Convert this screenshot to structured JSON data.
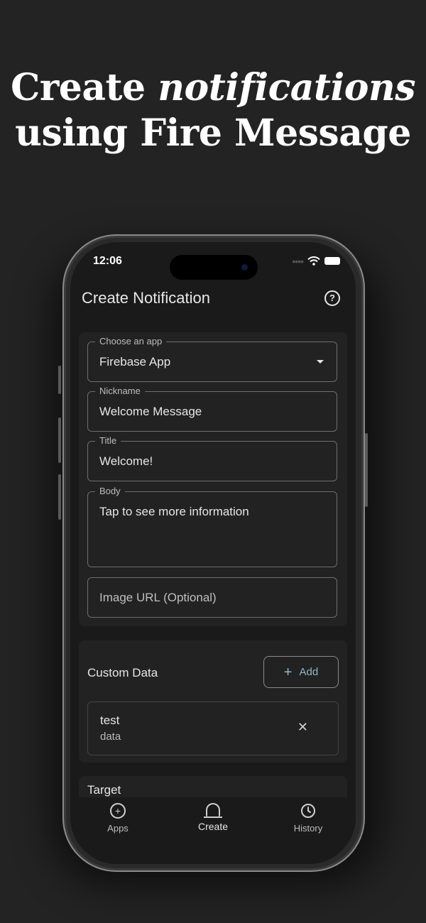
{
  "headline": {
    "line1_prefix": "Create ",
    "line1_emphasis": "notifications",
    "line2": "using Fire Message"
  },
  "status_bar": {
    "time": "12:06"
  },
  "header": {
    "title": "Create Notification",
    "help_icon": "help-circle-icon"
  },
  "form": {
    "app": {
      "label": "Choose an app",
      "value": "Firebase App"
    },
    "nickname": {
      "label": "Nickname",
      "value": "Welcome Message"
    },
    "title": {
      "label": "Title",
      "value": "Welcome!"
    },
    "body": {
      "label": "Body",
      "value": "Tap to see more information"
    },
    "image_url": {
      "placeholder": "Image URL (Optional)"
    }
  },
  "custom_data": {
    "title": "Custom Data",
    "add_label": "Add",
    "items": [
      {
        "key": "test",
        "value": "data"
      }
    ]
  },
  "target": {
    "title": "Target"
  },
  "bottom_nav": {
    "items": [
      {
        "label": "Apps",
        "icon": "plus-circle-icon"
      },
      {
        "label": "Create",
        "icon": "bell-icon",
        "active": true
      },
      {
        "label": "History",
        "icon": "clock-icon"
      }
    ]
  },
  "colors": {
    "background": "#232323",
    "screen": "#1a1a1a",
    "card": "#222222",
    "accent": "#8fb8c9"
  }
}
